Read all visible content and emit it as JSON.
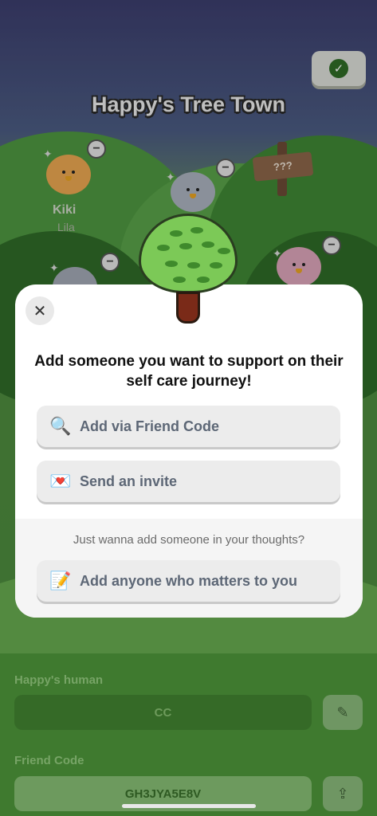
{
  "town": {
    "title": "Happy's Tree Town"
  },
  "sign": {
    "text": "???"
  },
  "friends": [
    {
      "name": "Kiki",
      "subtitle": "Lila"
    }
  ],
  "modal": {
    "close_label": "✕",
    "heading": "Add someone you want to support on their self care journey!",
    "options": [
      {
        "icon": "magnifier-icon",
        "glyph": "🔍",
        "label": "Add via Friend Code"
      },
      {
        "icon": "love-letter-icon",
        "glyph": "💌",
        "label": "Send an invite"
      }
    ],
    "subtext": "Just wanna add someone in your thoughts?",
    "anyone_option": {
      "icon": "memo-icon",
      "glyph": "📝",
      "label": "Add anyone who matters to you"
    }
  },
  "profile": {
    "human_label": "Happy's human",
    "human_value": "CC",
    "friend_code_label": "Friend Code",
    "friend_code_value": "GH3JYA5E8V"
  },
  "colors": {
    "grass": "#4a8a3a",
    "sky": "#3b3d6c",
    "modal_bg": "#ffffff",
    "option_bg": "#ececec",
    "option_text": "#5d6776",
    "tree_canopy": "#7cc957",
    "trunk": "#7a2a18"
  }
}
